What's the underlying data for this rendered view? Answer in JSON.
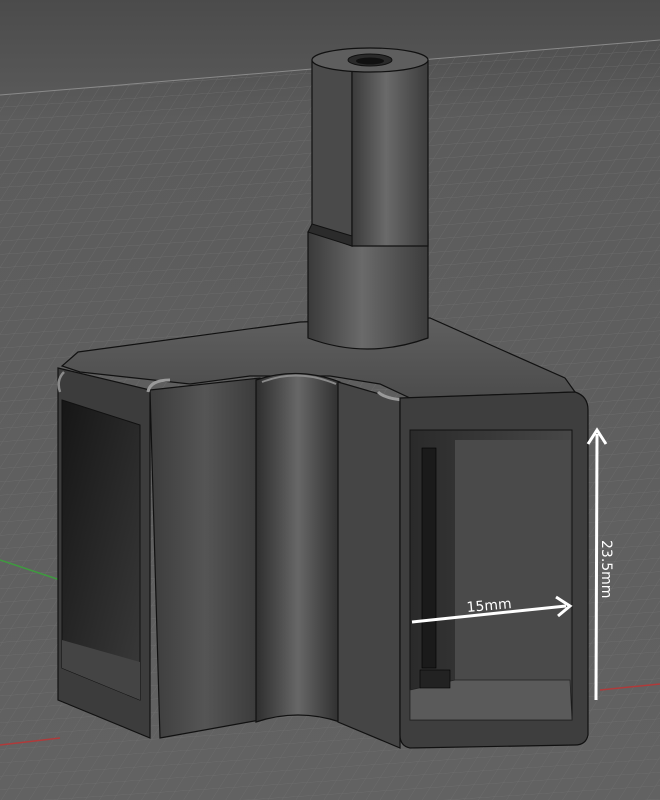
{
  "scene": {
    "background_color": "#5a5a5a",
    "grid_color": "#7a7a7a",
    "model_color": "#4a4a4a",
    "model_dark_color": "#1f1f1f",
    "edge_color": "#111111",
    "axis_green": "#3f9a3f",
    "axis_red": "#b03a3a"
  },
  "dimensions": {
    "width_label": "15mm",
    "height_label": "23.5mm",
    "arrow_color": "#ffffff"
  }
}
